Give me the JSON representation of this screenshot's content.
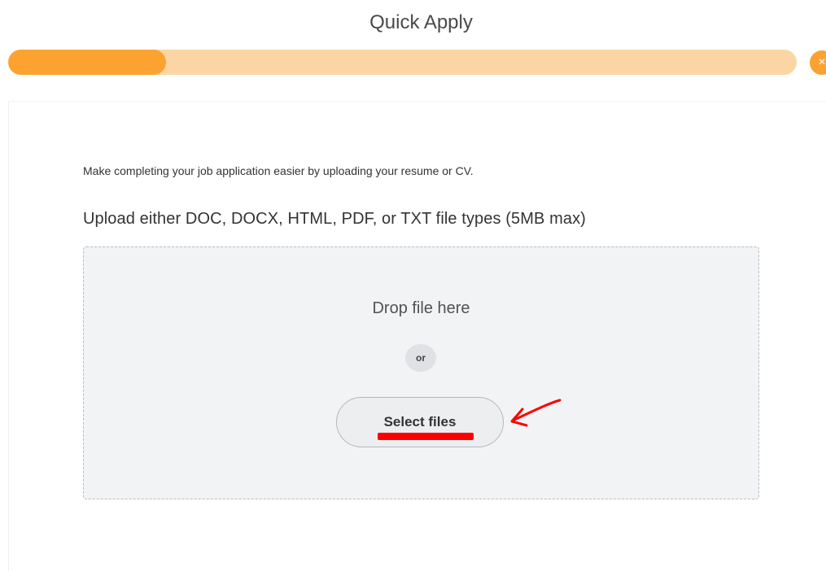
{
  "header": {
    "title": "Quick Apply"
  },
  "progress": {
    "fraction": 0.2,
    "bar_color": "#fba231",
    "track_color": "#fbd6a4",
    "next_step_icon": "close-icon"
  },
  "upload": {
    "intro": "Make completing your job application easier by uploading your resume or CV.",
    "heading": "Upload either DOC, DOCX, HTML, PDF, or TXT file types (5MB max)",
    "drop_text": "Drop file here",
    "or_text": "or",
    "select_label": "Select files"
  },
  "annotation": {
    "color": "#ff0000"
  }
}
